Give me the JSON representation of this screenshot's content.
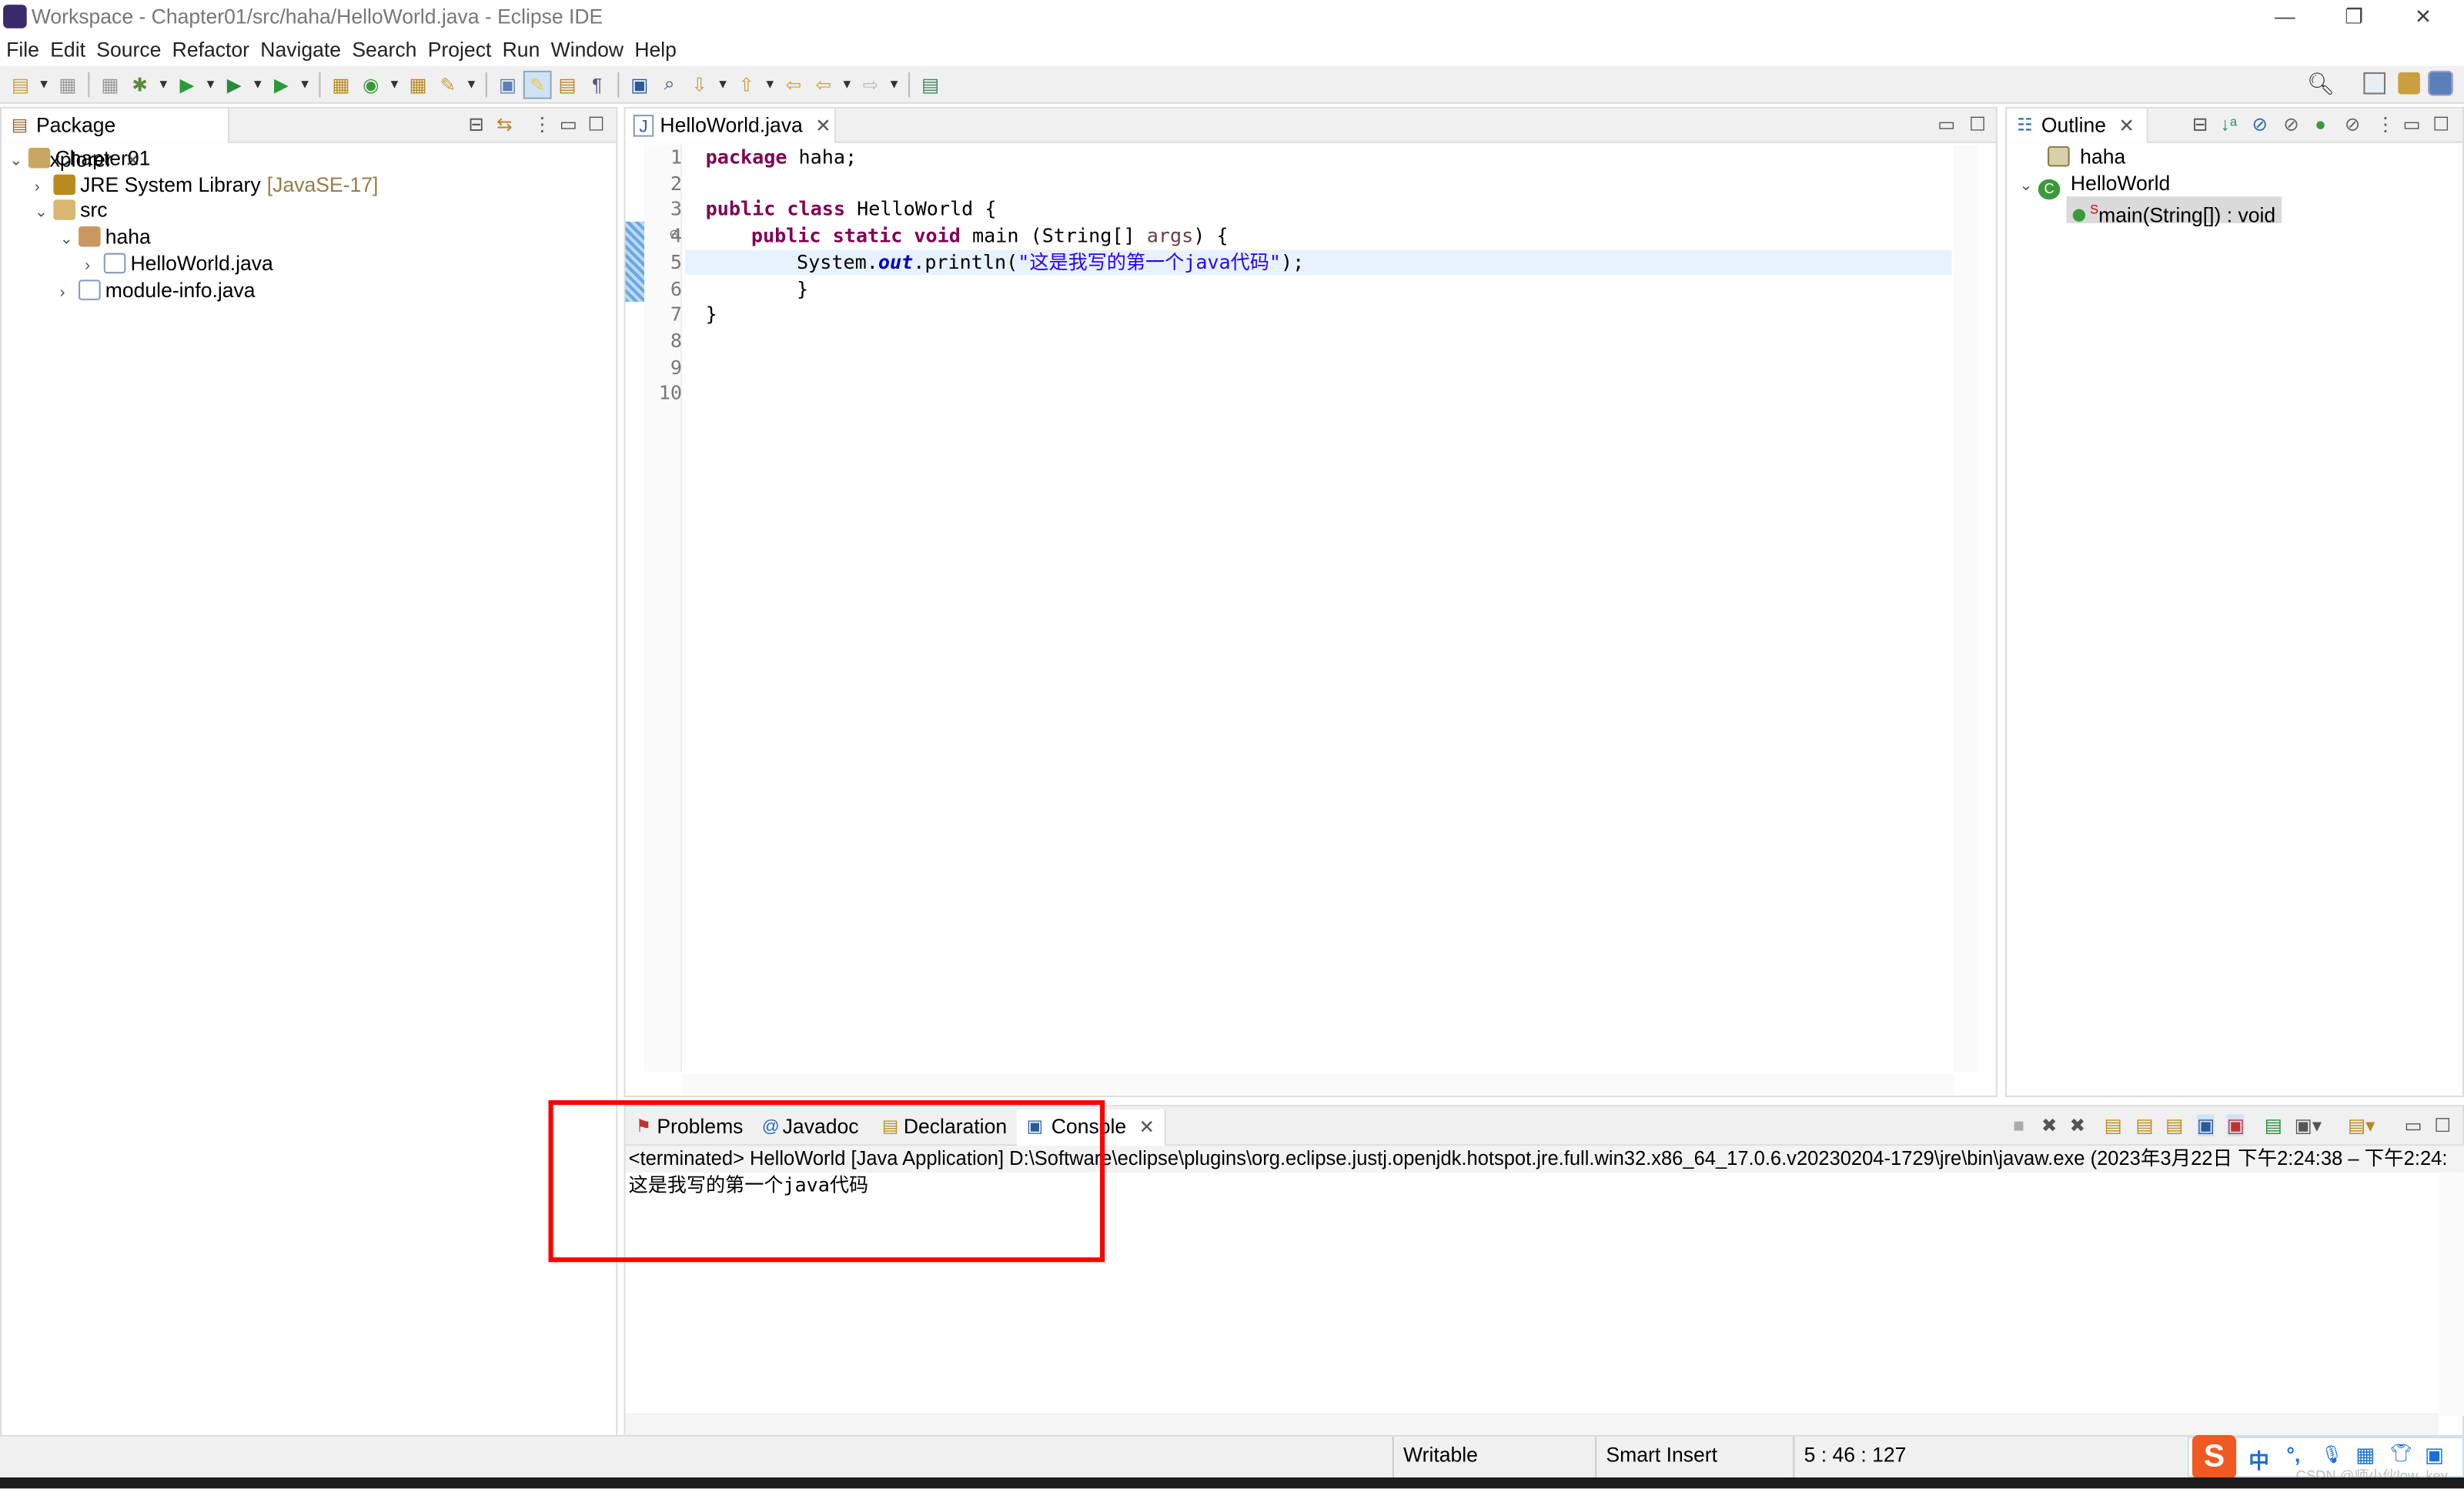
{
  "window": {
    "title": "Workspace - Chapter01/src/haha/HelloWorld.java - Eclipse IDE",
    "controls": [
      "—",
      "❐",
      "✕"
    ]
  },
  "menu": [
    "File",
    "Edit",
    "Source",
    "Refactor",
    "Navigate",
    "Search",
    "Project",
    "Run",
    "Window",
    "Help"
  ],
  "toolbar_icons": [
    "new-icon",
    "save-icon",
    "save-all-icon",
    "debug-icon",
    "run-icon",
    "coverage-icon",
    "run-external-icon",
    "new-java-project-icon",
    "new-class-icon",
    "open-type-icon",
    "open-task-icon",
    "open-perspective-icon",
    "toggle-highlight-icon",
    "mark-occurrences-icon",
    "show-whitespace-icon",
    "console-icon",
    "search-icon",
    "next-annotation-icon",
    "prev-annotation-icon",
    "last-edit-icon",
    "back-icon",
    "forward-icon",
    "pin-editor-icon"
  ],
  "package_explorer": {
    "tab": "Package Explorer",
    "tree": [
      {
        "label": "Chapter01",
        "depth": 0,
        "expanded": true,
        "icon": "project-icon"
      },
      {
        "label": "JRE System Library",
        "suffix": "[JavaSE-17]",
        "depth": 1,
        "expanded": false,
        "icon": "library-icon"
      },
      {
        "label": "src",
        "depth": 1,
        "expanded": true,
        "icon": "source-folder-icon"
      },
      {
        "label": "haha",
        "depth": 2,
        "expanded": true,
        "icon": "package-icon"
      },
      {
        "label": "HelloWorld.java",
        "depth": 3,
        "expanded": false,
        "icon": "java-file-icon"
      },
      {
        "label": "module-info.java",
        "depth": 2,
        "expanded": false,
        "icon": "java-file-icon"
      }
    ]
  },
  "editor": {
    "tab": "HelloWorld.java",
    "line_numbers": [
      "1",
      "2",
      "3",
      "4",
      "5",
      "6",
      "7",
      "8",
      "9",
      "10"
    ],
    "lines": {
      "l1": {
        "kw": "package",
        "rest": " haha;"
      },
      "l3": {
        "kw": "public class",
        "rest": " HelloWorld {"
      },
      "l4": {
        "kw": "public static void",
        "rest": " main (String[] ",
        "arg": "args",
        "end": ") {"
      },
      "l5": {
        "a": "System.",
        "fld": "out",
        "b": ".println(",
        "str": "\"这是我写的第一个java代码\"",
        "c": ");"
      },
      "l6": "}",
      "l7": "}"
    },
    "current_line": 5
  },
  "outline": {
    "tab": "Outline",
    "items": [
      {
        "label": "haha",
        "icon": "package-icon"
      },
      {
        "label": "HelloWorld",
        "icon": "class-icon"
      },
      {
        "label": "main(String[]) : void",
        "icon": "public-method-icon",
        "modifier": "S"
      }
    ]
  },
  "bottom": {
    "tabs": [
      "Problems",
      "Javadoc",
      "Declaration",
      "Console"
    ],
    "active_tab": "Console",
    "console_header": "<terminated> HelloWorld [Java Application] D:\\Software\\eclipse\\plugins\\org.eclipse.justj.openjdk.hotspot.jre.full.win32.x86_64_17.0.6.v20230204-1729\\jre\\bin\\javaw.exe  (2023年3月22日 下午2:24:38 – 下午2:24:",
    "console_output": "这是我写的第一个java代码"
  },
  "status": {
    "writable": "Writable",
    "insert_mode": "Smart Insert",
    "position": "5 : 46 : 127"
  },
  "ime": {
    "logo": "S",
    "items": [
      "中",
      "°,",
      "🎤",
      "▦",
      "👕",
      "▣"
    ],
    "watermark": "CSDN @师小伙low_key"
  },
  "colors": {
    "highlight_box": "#ff0000",
    "keyword": "#7f0055",
    "string": "#2a00ff",
    "current_line": "#e8f2fe"
  }
}
